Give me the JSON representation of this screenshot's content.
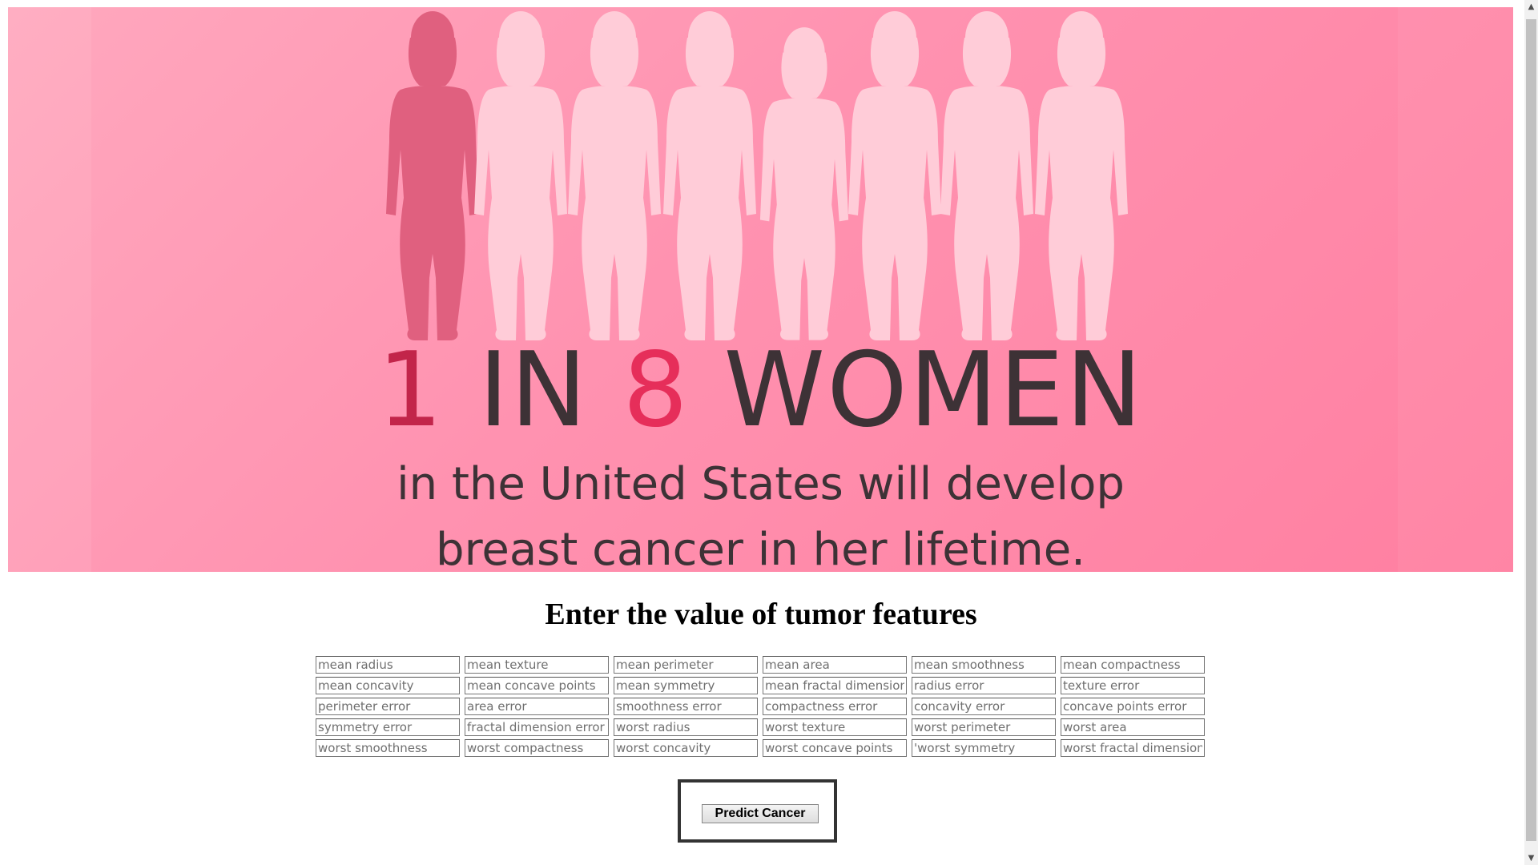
{
  "banner": {
    "stat_number_one": "1",
    "stat_in": "IN",
    "stat_number_eight": "8",
    "stat_women": "WOMEN",
    "stat_line_2": "in the United States will develop",
    "stat_line_3": "breast cancer in her lifetime.",
    "colors": {
      "background": "#ff92b0",
      "highlight_silhouette": "#e0607f",
      "silhouette": "#ffccd8",
      "number_one": "#c2254a",
      "number_eight": "#e62e5a",
      "text": "#3d3236"
    }
  },
  "form": {
    "heading": "Enter the value of tumor features",
    "fields": [
      [
        "mean radius",
        "mean texture",
        "mean perimeter",
        "mean area",
        "mean smoothness",
        "mean compactness"
      ],
      [
        "mean concavity",
        "mean concave points",
        "mean symmetry",
        "mean fractal dimension",
        "radius error",
        "texture error"
      ],
      [
        "perimeter error",
        "area error",
        "smoothness error",
        "compactness error",
        "concavity error",
        "concave points error"
      ],
      [
        "symmetry error",
        "fractal dimension error",
        "worst radius",
        "worst texture",
        "worst perimeter",
        "worst area"
      ],
      [
        "worst smoothness",
        "worst compactness",
        "worst concavity",
        "worst concave points",
        "'worst symmetry",
        "worst fractal dimension"
      ]
    ],
    "submit_label": "Predict Cancer"
  },
  "scrollbar": {
    "up_icon": "chevron-up-icon",
    "down_icon": "chevron-down-icon"
  }
}
